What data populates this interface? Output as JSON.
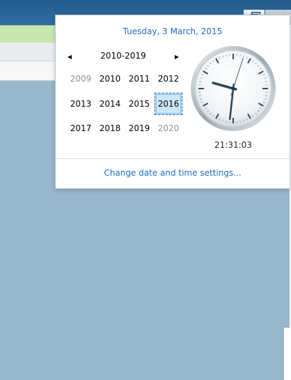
{
  "window": {
    "close_glyph": "✕"
  },
  "calendar": {
    "date_header": "Tuesday, 3 March, 2015",
    "decade_label": "2010-2019",
    "prev_icon": "◀",
    "next_icon": "▶",
    "years": [
      {
        "label": "2009",
        "state": "outside"
      },
      {
        "label": "2010",
        "state": "normal"
      },
      {
        "label": "2011",
        "state": "normal"
      },
      {
        "label": "2012",
        "state": "normal"
      },
      {
        "label": "2013",
        "state": "normal"
      },
      {
        "label": "2014",
        "state": "normal"
      },
      {
        "label": "2015",
        "state": "normal"
      },
      {
        "label": "2016",
        "state": "selected"
      },
      {
        "label": "2017",
        "state": "normal"
      },
      {
        "label": "2018",
        "state": "normal"
      },
      {
        "label": "2019",
        "state": "normal"
      },
      {
        "label": "2020",
        "state": "outside"
      }
    ]
  },
  "clock": {
    "time_text": "21:31:03",
    "hour": 21,
    "minute": 31,
    "second": 3
  },
  "footer": {
    "link_label": "Change date and time settings..."
  },
  "colors": {
    "link": "#1f6bbf",
    "desktop": "#98b6cc",
    "selected_fill": "#cce8fa"
  }
}
